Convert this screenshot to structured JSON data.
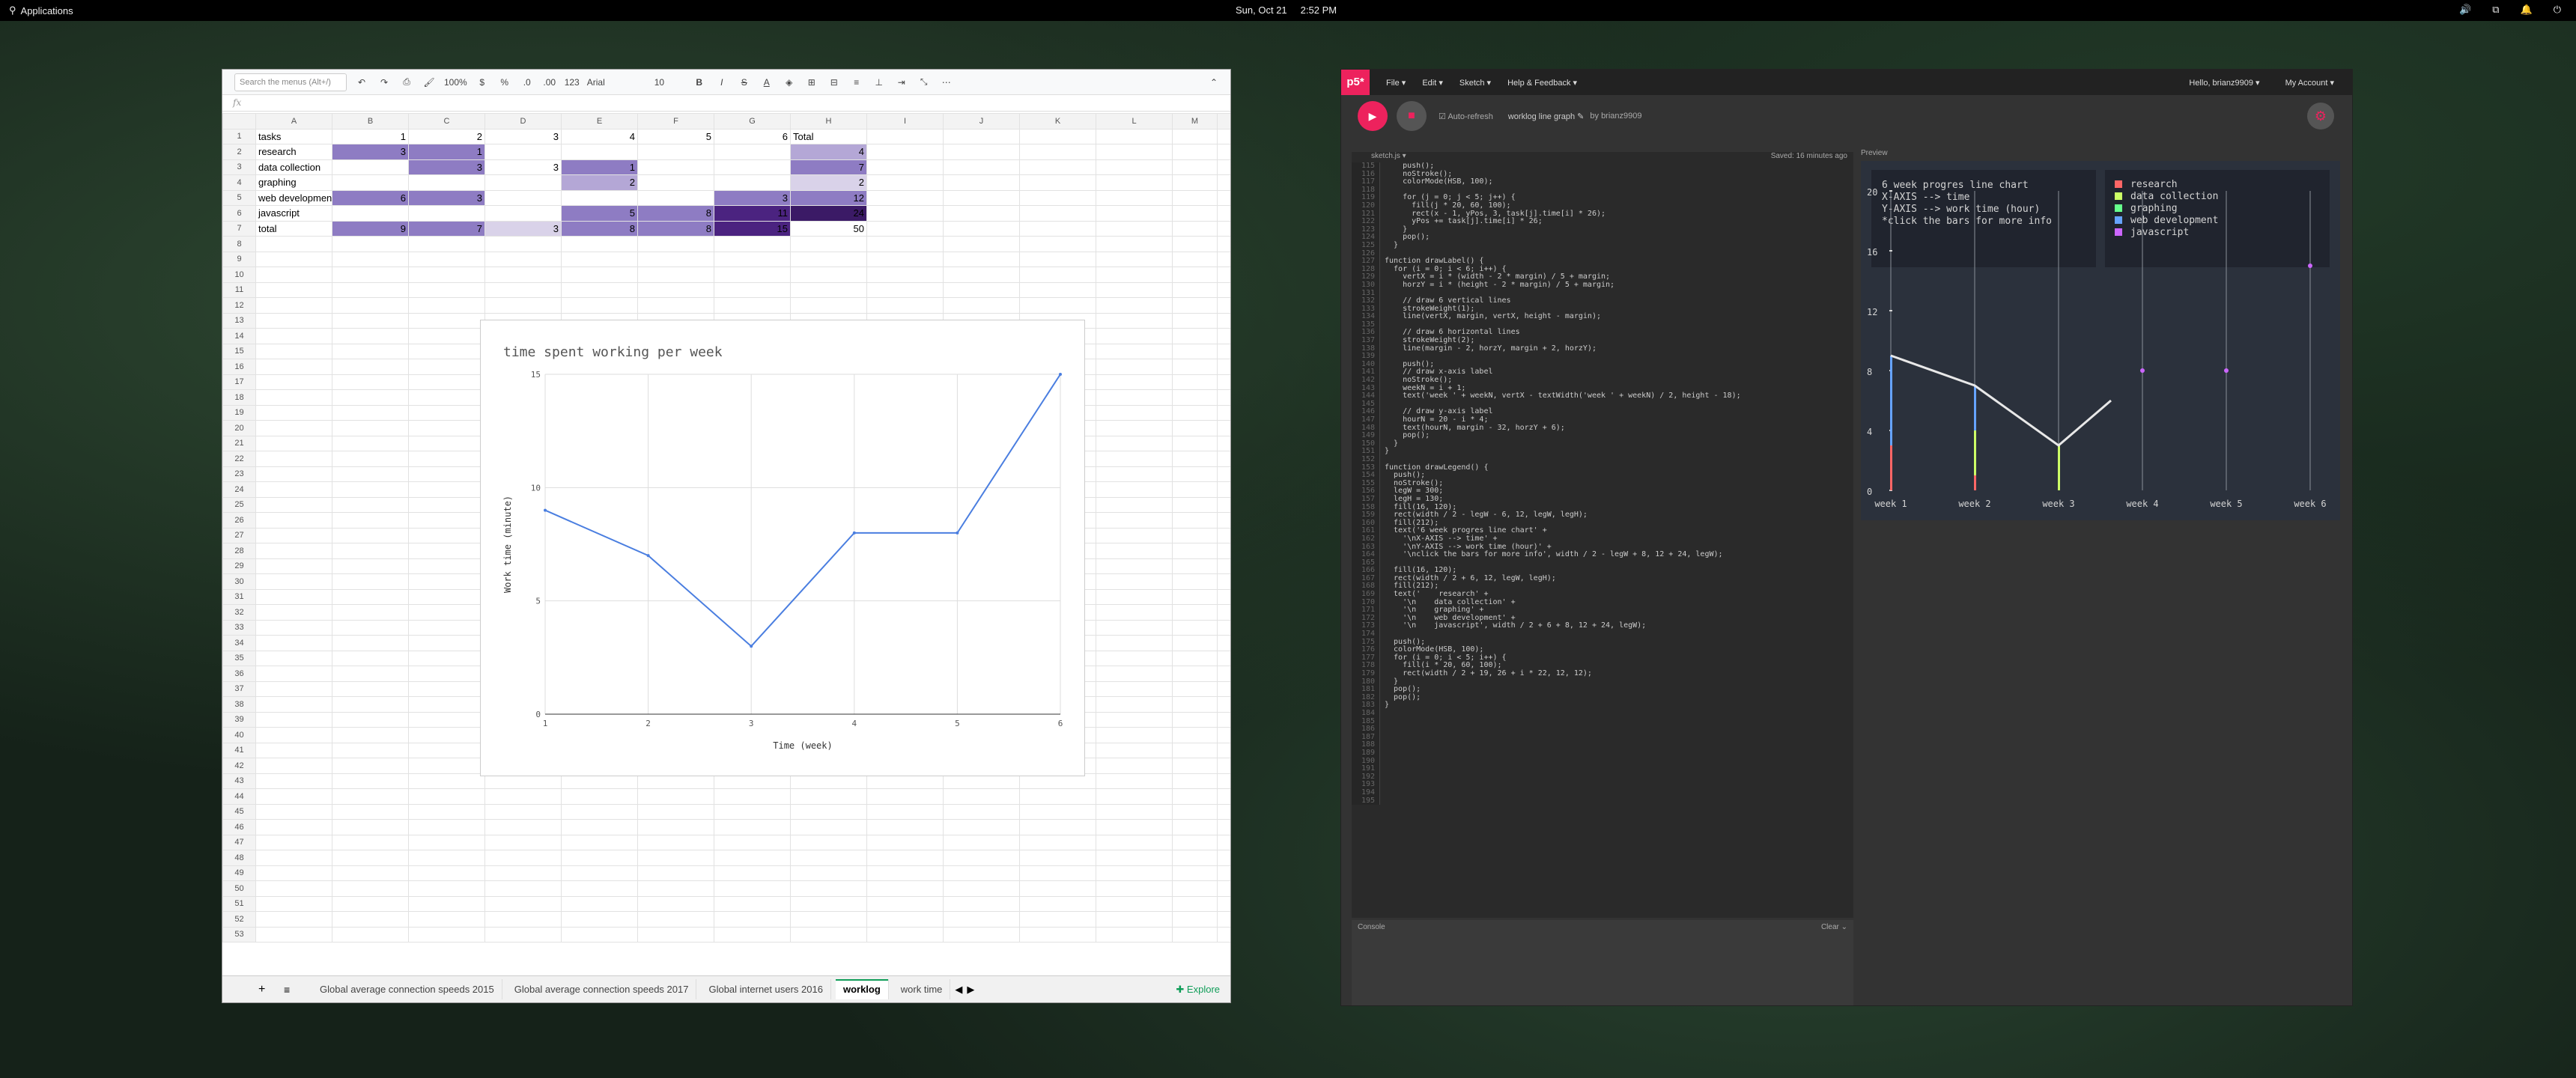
{
  "topbar": {
    "apps": "Applications",
    "date": "Sun, Oct 21",
    "time": "2:52 PM"
  },
  "sheets": {
    "search_placeholder": "Search the menus (Alt+/)",
    "zoom": "100%",
    "currency": "$",
    "percent": "%",
    "dec1": ".0",
    "dec2": ".00",
    "format": "123",
    "font": "Arial",
    "size": "10",
    "formula_label": "fx",
    "columns": [
      "A",
      "B",
      "C",
      "D",
      "E",
      "F",
      "G",
      "H",
      "I",
      "J",
      "K",
      "L",
      "M"
    ],
    "rows": [
      [
        "tasks",
        "1",
        "2",
        "3",
        "4",
        "5",
        "6",
        "Total"
      ],
      [
        "research",
        "3",
        "1",
        "",
        "",
        "",
        "",
        "4"
      ],
      [
        "data collection",
        "",
        "3",
        "3",
        "1",
        "",
        "",
        "7"
      ],
      [
        "graphing",
        "",
        "",
        "",
        "2",
        "",
        "",
        "2"
      ],
      [
        "web development",
        "6",
        "3",
        "",
        "",
        "",
        "3",
        "12"
      ],
      [
        "javascript",
        "",
        "",
        "",
        "5",
        "8",
        "11",
        "24"
      ],
      [
        "total",
        "9",
        "7",
        "3",
        "8",
        "8",
        "15",
        "50"
      ]
    ],
    "row_count": 53,
    "tabs": [
      "Global average connection speeds 2015",
      "Global average connection speeds 2017",
      "Global internet users 2016",
      "worklog",
      "work time"
    ],
    "active_tab": "worklog",
    "explore": "Explore",
    "add_sheet": "+",
    "sheet_list": "≡"
  },
  "sheet_chart": {
    "chart_data": {
      "type": "line",
      "title": "time spent working per week",
      "xlabel": "Time (week)",
      "ylabel": "Work time (minute)",
      "x": [
        1,
        2,
        3,
        4,
        5,
        6
      ],
      "series": [
        {
          "values": [
            9,
            7,
            3,
            8,
            8,
            15
          ]
        }
      ],
      "ylim": [
        0,
        15
      ],
      "yticks": [
        "0",
        "5",
        "10",
        "15"
      ],
      "xticks": [
        "1",
        "2",
        "3",
        "4",
        "5",
        "6"
      ],
      "color": "#4a7ee0"
    }
  },
  "p5": {
    "logo": "p5*",
    "menu": [
      "File ▾",
      "Edit ▾",
      "Sketch ▾",
      "Help & Feedback ▾"
    ],
    "user": "Hello, brianz9909 ▾",
    "account": "My Account ▾",
    "auto_refresh": "Auto-refresh",
    "sketch_name": "worklog line graph ✎",
    "by": "by brianz9909",
    "file_tab": "sketch.js ▾",
    "saved": "Saved: 16 minutes ago",
    "preview": "Preview",
    "console": "Console",
    "clear": "Clear ⌄",
    "start_line": 115,
    "code": [
      "    push();",
      "    noStroke();",
      "    colorMode(HSB, 100);",
      "",
      "    for (j = 0; j < 5; j++) {",
      "      fill(j * 20, 60, 100);",
      "      rect(x - 1, yPos, 3, task[j].time[i] * 26);",
      "      yPos += task[j].time[i] * 26;",
      "    }",
      "    pop();",
      "  }",
      "",
      "function drawLabel() {",
      "  for (i = 0; i < 6; i++) {",
      "    vertX = i * (width - 2 * margin) / 5 + margin;",
      "    horzY = i * (height - 2 * margin) / 5 + margin;",
      "",
      "    // draw 6 vertical lines",
      "    strokeWeight(1);",
      "    line(vertX, margin, vertX, height - margin);",
      "",
      "    // draw 6 horizontal lines",
      "    strokeWeight(2);",
      "    line(margin - 2, horzY, margin + 2, horzY);",
      "",
      "    push();",
      "    // draw x-axis label",
      "    noStroke();",
      "    weekN = i + 1;",
      "    text('week ' + weekN, vertX - textWidth('week ' + weekN) / 2, height - 18);",
      "",
      "    // draw y-axis label",
      "    hourN = 20 - i * 4;",
      "    text(hourN, margin - 32, horzY + 6);",
      "    pop();",
      "  }",
      "}",
      "",
      "function drawLegend() {",
      "  push();",
      "  noStroke();",
      "  legW = 300;",
      "  legH = 130;",
      "  fill(16, 120);",
      "  rect(width / 2 - legW - 6, 12, legW, legH);",
      "  fill(212);",
      "  text('6 week progres line chart' +",
      "    '\\nX-AXIS --> time' +",
      "    '\\nY-AXIS --> work time (hour)' +",
      "    '\\nclick the bars for more info', width / 2 - legW + 8, 12 + 24, legW);",
      "",
      "  fill(16, 120);",
      "  rect(width / 2 + 6, 12, legW, legH);",
      "  fill(212);",
      "  text('    research' +",
      "    '\\n    data collection' +",
      "    '\\n    graphing' +",
      "    '\\n    web development' +",
      "    '\\n    javascript', width / 2 + 6 + 8, 12 + 24, legW);",
      "",
      "  push();",
      "  colorMode(HSB, 100);",
      "  for (i = 0; i < 5; i++) {",
      "    fill(i * 20, 60, 100);",
      "    rect(width / 2 + 19, 26 + i * 22, 12, 12);",
      "  }",
      "  pop();",
      "  pop();",
      "}",
      "",
      "",
      "",
      "",
      "",
      "",
      "",
      "",
      "",
      "",
      "",
      ""
    ],
    "canvas": {
      "legend_text": [
        "6 week progres line chart",
        "X-AXIS --> time",
        "Y-AXIS --> work time (hour)",
        "*click the bars for more info"
      ],
      "tasks": [
        "research",
        "data collection",
        "graphing",
        "web development",
        "javascript"
      ],
      "task_colors": [
        "#ff6666",
        "#ccff66",
        "#66ff8c",
        "#66a3ff",
        "#cc66ff"
      ],
      "weeks": [
        "week 1",
        "week 2",
        "week 3",
        "week 4",
        "week 5",
        "week 6"
      ],
      "yticks": [
        "20",
        "16",
        "12",
        "8",
        "4",
        "0"
      ],
      "chart_data": {
        "type": "line",
        "x": [
          "week 1",
          "week 2",
          "week 3",
          "week 4"
        ],
        "series": [
          {
            "values": [
              9,
              7,
              3,
              6
            ]
          }
        ],
        "ylim": [
          0,
          20
        ]
      }
    }
  }
}
